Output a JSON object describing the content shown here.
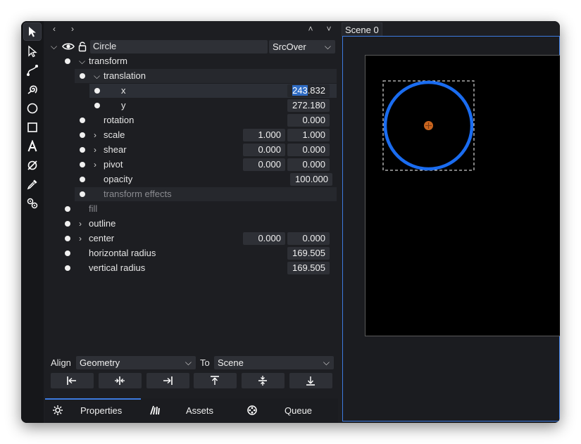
{
  "toolbar": {
    "tools": [
      {
        "name": "select-arrow-icon",
        "selected": true
      },
      {
        "name": "node-arrow-icon"
      },
      {
        "name": "bezier-path-icon"
      },
      {
        "name": "spiral-icon"
      },
      {
        "name": "circle-icon"
      },
      {
        "name": "rectangle-icon"
      },
      {
        "name": "text-icon"
      },
      {
        "name": "null-object-icon"
      },
      {
        "name": "eyedropper-icon"
      },
      {
        "name": "gears-icon"
      }
    ]
  },
  "nav": {
    "back": "‹",
    "forward": "›",
    "up": "˄",
    "down": "˅"
  },
  "layer": {
    "name": "Circle",
    "blend_mode": "SrcOver"
  },
  "props": {
    "transform": "transform",
    "translation": "translation",
    "x_label": "x",
    "x_value_selected": "243",
    "x_value_rest": ".832",
    "y_label": "y",
    "y_value": "272.180",
    "rotation_label": "rotation",
    "rotation_value": "0.000",
    "scale_label": "scale",
    "scale_x": "1.000",
    "scale_y": "1.000",
    "shear_label": "shear",
    "shear_x": "0.000",
    "shear_y": "0.000",
    "pivot_label": "pivot",
    "pivot_x": "0.000",
    "pivot_y": "0.000",
    "opacity_label": "opacity",
    "opacity_value": "100.000",
    "transform_effects": "transform effects",
    "fill": "fill",
    "outline": "outline",
    "center_label": "center",
    "center_x": "0.000",
    "center_y": "0.000",
    "hradius_label": "horizontal radius",
    "hradius_value": "169.505",
    "vradius_label": "vertical radius",
    "vradius_value": "169.505"
  },
  "align": {
    "label": "Align",
    "mode": "Geometry",
    "to_label": "To",
    "target": "Scene"
  },
  "tabs": {
    "properties": "Properties",
    "assets": "Assets",
    "queue": "Queue"
  },
  "scene": {
    "tab": "Scene 0"
  },
  "colors": {
    "accent": "#3d7be0",
    "circle_stroke": "#1a6cf0",
    "center_marker": "#c8641e",
    "selection": "#2f6cc4"
  }
}
